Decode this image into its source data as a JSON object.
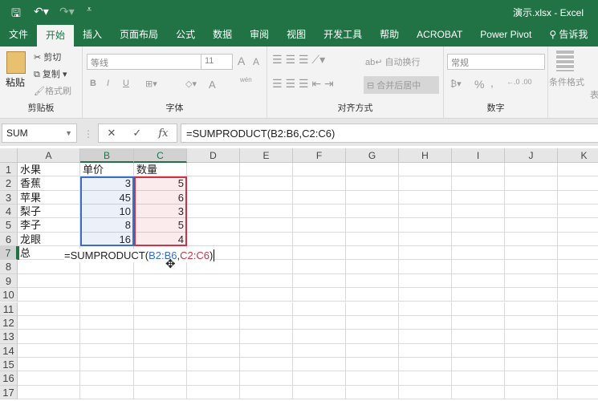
{
  "titlebar": {
    "title": "演示.xlsx  -  Excel",
    "save_icon": "save-icon",
    "undo_icon": "undo-icon",
    "redo_icon": "redo-icon"
  },
  "tabs": [
    "文件",
    "开始",
    "插入",
    "页面布局",
    "公式",
    "数据",
    "审阅",
    "视图",
    "开发工具",
    "帮助",
    "ACROBAT",
    "Power Pivot",
    "告诉我"
  ],
  "active_tab": 1,
  "ribbon": {
    "clipboard": {
      "label": "剪贴板",
      "paste": "粘贴",
      "cut": "剪切",
      "copy": "复制",
      "format_painter": "格式刷"
    },
    "font": {
      "label": "字体",
      "font_name": "等线",
      "font_size": "11",
      "bold": "B",
      "italic": "I",
      "underline": "U",
      "font_color": "A",
      "grow": "A",
      "shrink": "A",
      "phonetic": "wén"
    },
    "alignment": {
      "label": "对齐方式",
      "wrap": "自动换行",
      "merge": "合并后居中"
    },
    "number": {
      "label": "数字",
      "format": "常规",
      "percent": "%",
      "comma": ","
    },
    "styles": {
      "conditional": "条件格式",
      "table": "表"
    }
  },
  "formula_bar": {
    "name_box": "SUM",
    "cancel": "✕",
    "enter": "✓",
    "fx": "fx",
    "formula": "=SUMPRODUCT(B2:B6,C2:C6)"
  },
  "columns": [
    "A",
    "B",
    "C",
    "D",
    "E",
    "F",
    "G",
    "H",
    "I",
    "J",
    "K"
  ],
  "rows": [
    [
      "水果",
      "单价",
      "数量"
    ],
    [
      "香蕉",
      "3",
      "5"
    ],
    [
      "苹果",
      "45",
      "6"
    ],
    [
      "梨子",
      "10",
      "3"
    ],
    [
      "李子",
      "8",
      "5"
    ],
    [
      "龙眼",
      "16",
      "4"
    ],
    [
      "总",
      "",
      ""
    ]
  ],
  "row_count": 17,
  "editor": {
    "prefix": "=SUMPRODUCT(",
    "ref1": "B2:B6",
    "sep": ",",
    "ref2": "C2:C6",
    "suffix": ")"
  }
}
